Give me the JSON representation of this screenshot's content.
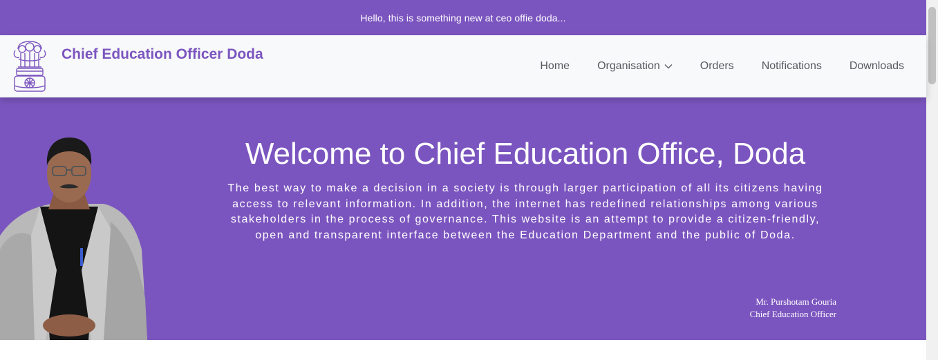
{
  "announcement": {
    "text": "Hello, this is something new at ceo offie doda..."
  },
  "brand": {
    "title": "Chief Education Officer Doda",
    "logo_icon": "state-emblem-icon",
    "color": "#7b55bf"
  },
  "nav": {
    "items": [
      {
        "label": "Home"
      },
      {
        "label": "Organisation",
        "has_dropdown": true
      },
      {
        "label": "Orders"
      },
      {
        "label": "Notifications"
      },
      {
        "label": "Downloads"
      }
    ]
  },
  "hero": {
    "title": "Welcome to Chief Education Office, Doda",
    "description": "The best way to make a decision in a society is through larger participation of all its citizens having access to relevant information. In addition, the internet has redefined relationships among various stakeholders in the process of governance. This website is an attempt to provide a citizen-friendly, open and transparent interface between the Education Department and the public of Doda.",
    "officer_name": "Mr. Purshotam Gouria",
    "officer_role": "Chief Education Officer",
    "background": "#7b55bf"
  }
}
